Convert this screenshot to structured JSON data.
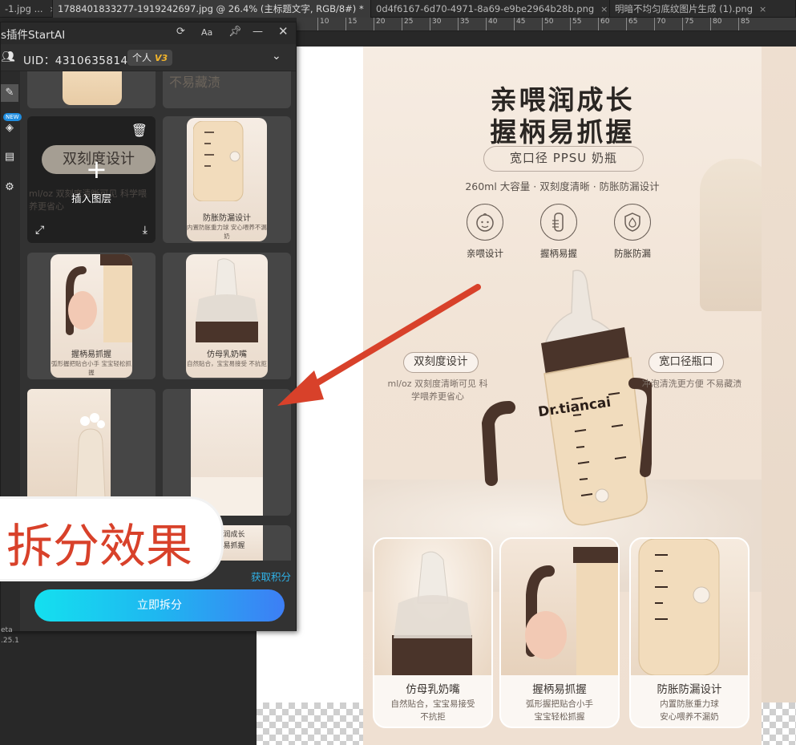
{
  "tabs": [
    {
      "label": "-1.jpg ...",
      "close": "×"
    },
    {
      "label": "1788401833277-1919242697.jpg @ 26.4% (主标题文字, RGB/8#) *",
      "close": "×",
      "active": true
    },
    {
      "label": "0d4f6167-6d70-4971-8a69-e9be2964b28b.png",
      "close": "×"
    },
    {
      "label": "明暗不均匀底纹图片生成 (1).png",
      "close": "×"
    }
  ],
  "ruler": [
    "10",
    "15",
    "20",
    "25",
    "30",
    "35",
    "40",
    "45",
    "50",
    "55",
    "60",
    "65",
    "70",
    "75",
    "80",
    "85"
  ],
  "panel": {
    "title": "s插件StartAI",
    "uid": "UID：4310635814",
    "plan": "个人",
    "plan_tier": "V3",
    "new_tag": "NEW",
    "cells": {
      "top_left_ghost": "不易藏渍",
      "overlay_chip": "双刻度设计",
      "insert_label": "插入图层",
      "ghost_overlay": "ml/oz 双刻度清晰可见 科学喂养更省心",
      "thumb_leak_title": "防胀防漏设计",
      "thumb_leak_sub": "内置防胀重力球 安心喂养不漏奶",
      "thumb_grip_title": "握柄易抓握",
      "thumb_grip_sub": "弧形握把贴合小手 宝宝轻松抓握",
      "thumb_nipple_title": "仿母乳奶嘴",
      "thumb_nipple_sub": "自然贴合，宝宝易接受 不抗拒",
      "thumb_small_title": "握柄易抓握",
      "thumb_small_sub": "亲喂润成长"
    },
    "get_points": "获取积分",
    "split_button": "立即拆分",
    "beta": "eta",
    "version": ".25.1"
  },
  "big_label": "拆分效果",
  "poster": {
    "title_line1": "亲喂润成长",
    "title_line2": "握柄易抓握",
    "pill": "宽口径 PPSU 奶瓶",
    "sub": "260ml 大容量 · 双刻度清晰 · 防胀防漏设计",
    "features": [
      "亲喂设计",
      "握柄易握",
      "防胀防漏"
    ],
    "callout_left": "双刻度设计",
    "callout_left_sub": "ml/oz 双刻度清晰可见 科学喂养更省心",
    "callout_right": "宽口径瓶口",
    "callout_right_sub": "冲泡清洗更方便 不易藏渍",
    "brand": "Dr.tiancai",
    "cards": [
      {
        "title": "仿母乳奶嘴",
        "sub1": "自然贴合，宝宝易接受",
        "sub2": "不抗拒"
      },
      {
        "title": "握柄易抓握",
        "sub1": "弧形握把贴合小手",
        "sub2": "宝宝轻松抓握"
      },
      {
        "title": "防胀防漏设计",
        "sub1": "内置防胀重力球",
        "sub2": "安心喂养不漏奶"
      }
    ]
  },
  "colors": {
    "accent": "#2fb2e8",
    "arrow": "#d8412a",
    "button_start": "#14e0ef",
    "button_end": "#3d7ef5"
  }
}
